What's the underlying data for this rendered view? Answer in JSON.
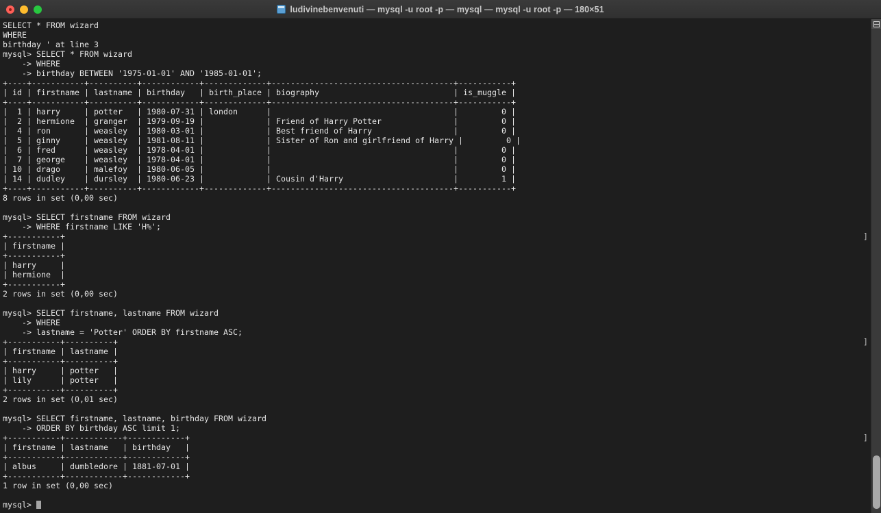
{
  "window": {
    "app": "Terminal",
    "title": "ludivinebenvenuti — mysql -u root -p — mysql — mysql -u root -p — 180×51",
    "icon": "terminal-folder-icon",
    "colors": {
      "titlebar_bg": "#333333",
      "terminal_bg": "#1e1e1e",
      "terminal_fg": "#e6e6e6",
      "close": "#ff5f57",
      "minimize": "#febc2e",
      "zoom": "#28c840",
      "scrollbar_track": "#3a3a3a",
      "scrollbar_thumb": "#a8a8a8"
    },
    "traffic_lights": [
      {
        "name": "close-button",
        "label": "Close"
      },
      {
        "name": "minimize-button",
        "label": "Minimize"
      },
      {
        "name": "zoom-button",
        "label": "Zoom"
      }
    ]
  },
  "terminal": {
    "cols": 180,
    "rows": 51,
    "prompt": "mysql>",
    "continuation": "    ->",
    "cursor_char": "█",
    "lines": [
      "SELECT * FROM wizard",
      "WHERE",
      "birthday ' at line 3",
      "mysql> SELECT * FROM wizard",
      "    -> WHERE",
      "    -> birthday BETWEEN '1975-01-01' AND '1985-01-01';",
      "+----+-----------+----------+------------+-------------+--------------------------------------+-----------+",
      "| id | firstname | lastname | birthday   | birth_place | biography                            | is_muggle |",
      "+----+-----------+----------+------------+-------------+--------------------------------------+-----------+",
      "|  1 | harry     | potter   | 1980-07-31 | london      |                                      |         0 |",
      "|  2 | hermione  | granger  | 1979-09-19 |             | Friend of Harry Potter               |         0 |",
      "|  4 | ron       | weasley  | 1980-03-01 |             | Best friend of Harry                 |         0 |",
      "|  5 | ginny     | weasley  | 1981-08-11 |             | Sister of Ron and girlfriend of Harry |         0 |",
      "|  6 | fred      | weasley  | 1978-04-01 |             |                                      |         0 |",
      "|  7 | george    | weasley  | 1978-04-01 |             |                                      |         0 |",
      "| 10 | drago     | malefoy  | 1980-06-05 |             |                                      |         0 |",
      "| 14 | dudley    | dursley  | 1980-06-23 |             | Cousin d'Harry                       |         1 |",
      "+----+-----------+----------+------------+-------------+--------------------------------------+-----------+",
      "8 rows in set (0,00 sec)",
      "",
      "mysql> SELECT firstname FROM wizard",
      "    -> WHERE firstname LIKE 'H%';",
      "+-----------+",
      "| firstname |",
      "+-----------+",
      "| harry     |",
      "| hermione  |",
      "+-----------+",
      "2 rows in set (0,00 sec)",
      "",
      "mysql> SELECT firstname, lastname FROM wizard",
      "    -> WHERE",
      "    -> lastname = 'Potter' ORDER BY firstname ASC;",
      "+-----------+----------+",
      "| firstname | lastname |",
      "+-----------+----------+",
      "| harry     | potter   |",
      "| lily      | potter   |",
      "+-----------+----------+",
      "2 rows in set (0,01 sec)",
      "",
      "mysql> SELECT firstname, lastname, birthday FROM wizard",
      "    -> ORDER BY birthday ASC limit 1;",
      "+-----------+------------+------------+",
      "| firstname | lastname   | birthday   |",
      "+-----------+------------+------------+",
      "| albus     | dumbledore | 1881-07-01 |",
      "+-----------+------------+------------+",
      "1 row in set (0,00 sec)",
      "",
      "mysql> "
    ],
    "prompt_marks": [
      {
        "glyph": "]",
        "line_index": 22
      },
      {
        "glyph": "]",
        "line_index": 33
      },
      {
        "glyph": "]",
        "line_index": 43
      }
    ],
    "queries": [
      {
        "sql": "SELECT * FROM wizard WHERE birthday BETWEEN '1975-01-01' AND '1985-01-01';",
        "result_columns": [
          "id",
          "firstname",
          "lastname",
          "birthday",
          "birth_place",
          "biography",
          "is_muggle"
        ],
        "result_rows": [
          [
            "1",
            "harry",
            "potter",
            "1980-07-31",
            "london",
            "",
            "0"
          ],
          [
            "2",
            "hermione",
            "granger",
            "1979-09-19",
            "",
            "Friend of Harry Potter",
            "0"
          ],
          [
            "4",
            "ron",
            "weasley",
            "1980-03-01",
            "",
            "Best friend of Harry",
            "0"
          ],
          [
            "5",
            "ginny",
            "weasley",
            "1981-08-11",
            "",
            "Sister of Ron and girlfriend of Harry",
            "0"
          ],
          [
            "6",
            "fred",
            "weasley",
            "1978-04-01",
            "",
            "",
            "0"
          ],
          [
            "7",
            "george",
            "weasley",
            "1978-04-01",
            "",
            "",
            "0"
          ],
          [
            "10",
            "drago",
            "malefoy",
            "1980-06-05",
            "",
            "",
            "0"
          ],
          [
            "14",
            "dudley",
            "dursley",
            "1980-06-23",
            "",
            "Cousin d'Harry",
            "1"
          ]
        ],
        "status": "8 rows in set (0,00 sec)"
      },
      {
        "sql": "SELECT firstname FROM wizard WHERE firstname LIKE 'H%';",
        "result_columns": [
          "firstname"
        ],
        "result_rows": [
          [
            "harry"
          ],
          [
            "hermione"
          ]
        ],
        "status": "2 rows in set (0,00 sec)"
      },
      {
        "sql": "SELECT firstname, lastname FROM wizard WHERE lastname = 'Potter' ORDER BY firstname ASC;",
        "result_columns": [
          "firstname",
          "lastname"
        ],
        "result_rows": [
          [
            "harry",
            "potter"
          ],
          [
            "lily",
            "potter"
          ]
        ],
        "status": "2 rows in set (0,01 sec)"
      },
      {
        "sql": "SELECT firstname, lastname, birthday FROM wizard ORDER BY birthday ASC limit 1;",
        "result_columns": [
          "firstname",
          "lastname",
          "birthday"
        ],
        "result_rows": [
          [
            "albus",
            "dumbledore",
            "1881-07-01"
          ]
        ],
        "status": "1 row in set (0,00 sec)"
      }
    ]
  },
  "scrollbar": {
    "pane_button_label": "split-pane"
  }
}
